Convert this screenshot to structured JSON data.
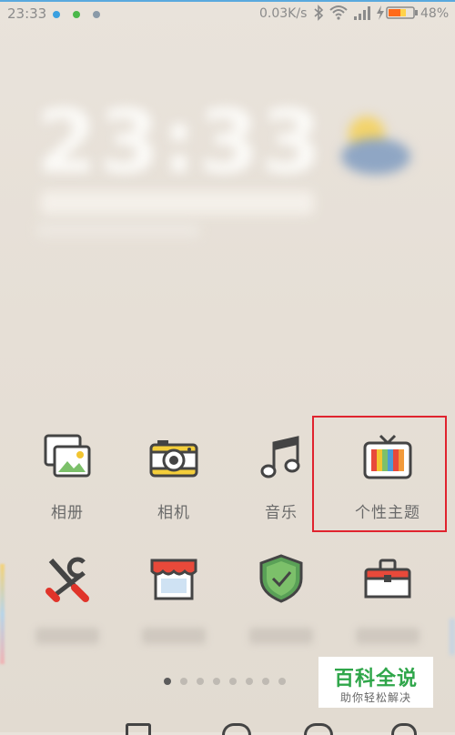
{
  "status_bar": {
    "time": "23:33",
    "network_speed": "0.03K/s",
    "battery_percent": "48%",
    "notification_dot_colors": [
      "#3aa0e0",
      "#4ab84a",
      "#8a9aa8"
    ]
  },
  "apps_row1": [
    {
      "label": "相册",
      "icon": "gallery-icon"
    },
    {
      "label": "相机",
      "icon": "camera-icon"
    },
    {
      "label": "音乐",
      "icon": "music-icon"
    },
    {
      "label": "个性主题",
      "icon": "themes-tv-icon"
    }
  ],
  "apps_row2": [
    {
      "icon": "tools-icon"
    },
    {
      "icon": "store-icon"
    },
    {
      "icon": "security-shield-icon"
    },
    {
      "icon": "toolbox-icon"
    }
  ],
  "pager": {
    "pages": 8,
    "active_index": 0
  },
  "watermark": {
    "main": "百科全说",
    "sub": "助你轻松解决"
  },
  "colors": {
    "highlight": "#e0232e",
    "accent": "#2fa64a"
  }
}
